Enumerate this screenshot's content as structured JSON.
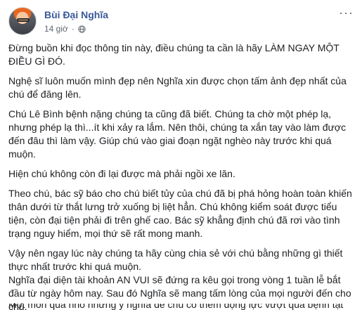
{
  "author": {
    "name": "Bùi Đại Nghĩa",
    "time": "14 giờ",
    "time_separator": "·",
    "audience_icon": "globe-icon"
  },
  "menu": {
    "icon": "more-options-icon",
    "label": "···"
  },
  "post": {
    "paragraphs": [
      {
        "lines": [
          "Đừng buồn khi đọc thông tin này, điều chúng ta cần là hãy LÀM NGAY MỘT",
          "ĐIỀU GÌ ĐÓ."
        ]
      },
      {
        "lines": [
          "Nghệ sĩ luôn muốn mình đẹp nên Nghĩa xin được chọn tấm ảnh đẹp nhất của",
          "chú để đăng lên."
        ]
      },
      {
        "lines": [
          "Chú Lê Bình bệnh nặng chúng ta cũng đã biết. Chúng ta chờ một phép lạ,",
          "nhưng phép lạ thì...ít khi xảy ra lắm. Nên thôi, chúng ta xắn tay vào làm được",
          "đến đâu thì làm vậy. Giúp chú vào giai đoạn ngặt nghèo này trước khi quá",
          "muộn."
        ]
      },
      {
        "lines": [
          "Hiện chú không còn đi lại được mà phải ngồi xe lăn."
        ]
      },
      {
        "lines": [
          "Theo chú, bác sỹ báo cho chú biết tủy của chú đã bị phá hỏng hoàn toàn khiến",
          "thân dưới từ thắt lưng trở xuống bị liệt hẳn. Chú không kiểm soát được tiểu",
          "tiện, còn đại tiện phải đi trên ghế cao. Bác sỹ khẳng định chú đã rơi vào tình",
          "trạng nguy hiểm, mọi thứ sẽ rất mong manh."
        ]
      },
      {
        "lines": [
          "Vậy nên ngay lúc này chúng ta hãy cùng chia sẻ với chú bằng những gì thiết",
          "thực nhất trước khi quá muộn."
        ]
      },
      {
        "lines": [
          "Nghĩa đại diện tài khoản AN VUI sẽ đứng ra kêu gọi trong vòng 1 tuần lễ bắt",
          "đầu từ ngày hôm nay. Sau đó Nghĩa sẽ mang tấm lòng của mọi người đến cho",
          "chú."
        ]
      }
    ],
    "cut_line": "Một món quà nhỏ nhưng ý nghĩa để chú có thêm động lực vượt qua bệnh tật này."
  }
}
